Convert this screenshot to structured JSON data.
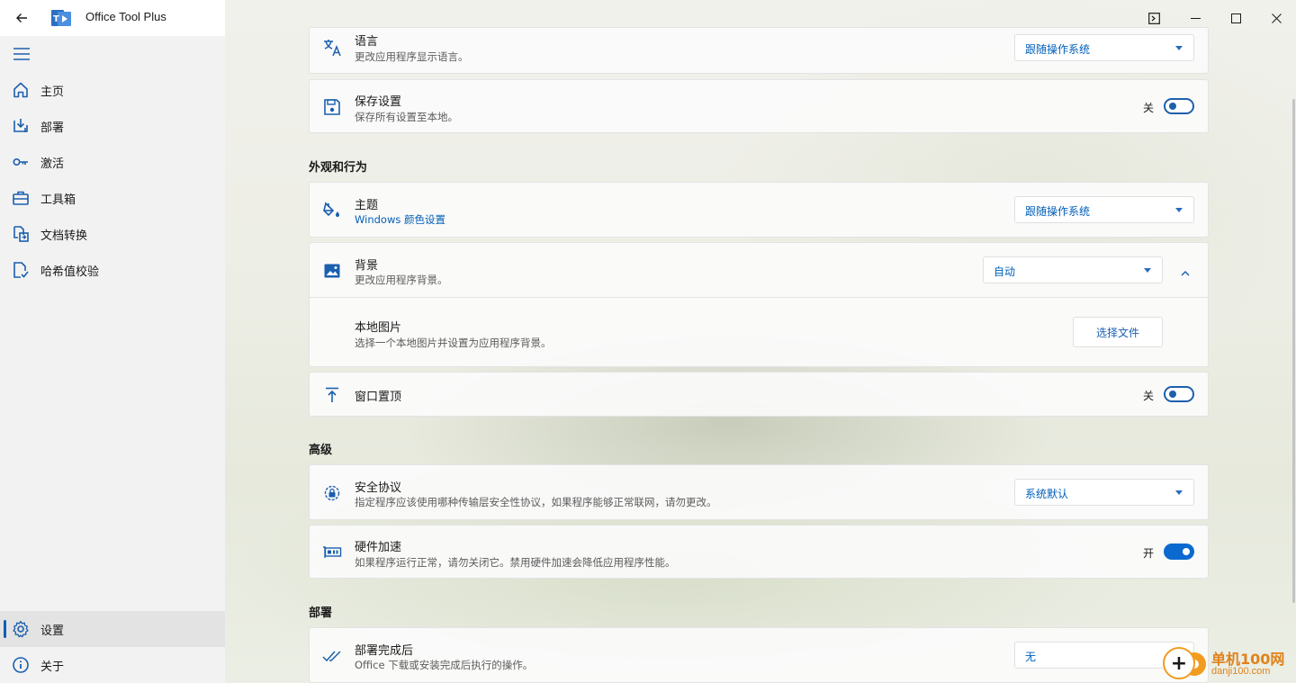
{
  "app": {
    "title": "Office Tool Plus"
  },
  "window_controls": {
    "terminal": "terminal-icon",
    "minimize": "minimize-icon",
    "maximize": "maximize-icon",
    "close": "close-icon"
  },
  "sidebar": {
    "items": [
      {
        "label": "主页",
        "icon": "home-icon"
      },
      {
        "label": "部署",
        "icon": "deploy-icon"
      },
      {
        "label": "激活",
        "icon": "key-icon"
      },
      {
        "label": "工具箱",
        "icon": "toolbox-icon"
      },
      {
        "label": "文档转换",
        "icon": "convert-icon"
      },
      {
        "label": "哈希值校验",
        "icon": "hash-check-icon"
      }
    ],
    "bottom": [
      {
        "label": "设置",
        "icon": "gear-icon",
        "selected": true
      },
      {
        "label": "关于",
        "icon": "info-icon"
      }
    ]
  },
  "settings": {
    "language": {
      "title": "语言",
      "desc": "更改应用程序显示语言。",
      "value": "跟随操作系统"
    },
    "save": {
      "title": "保存设置",
      "desc": "保存所有设置至本地。",
      "state": "关"
    },
    "section_appearance": "外观和行为",
    "theme": {
      "title": "主题",
      "link": "Windows 颜色设置",
      "value": "跟随操作系统"
    },
    "background": {
      "title": "背景",
      "desc": "更改应用程序背景。",
      "value": "自动"
    },
    "local_image": {
      "title": "本地图片",
      "desc": "选择一个本地图片并设置为应用程序背景。",
      "button": "选择文件"
    },
    "topmost": {
      "title": "窗口置顶",
      "state": "关"
    },
    "section_advanced": "高级",
    "security": {
      "title": "安全协议",
      "desc": "指定程序应该使用哪种传输层安全性协议，如果程序能够正常联网，请勿更改。",
      "value": "系统默认"
    },
    "hardware": {
      "title": "硬件加速",
      "desc": "如果程序运行正常，请勿关闭它。禁用硬件加速会降低应用程序性能。",
      "state": "开"
    },
    "section_deploy": "部署",
    "after_deploy": {
      "title": "部署完成后",
      "desc": "Office 下载或安装完成后执行的操作。",
      "value": "无"
    }
  },
  "watermark": {
    "name": "单机100网",
    "url": "danji100.com"
  },
  "colors": {
    "accent": "#005fb8",
    "toggle_on": "#0a6ad0",
    "watermark": "#e0821a"
  }
}
